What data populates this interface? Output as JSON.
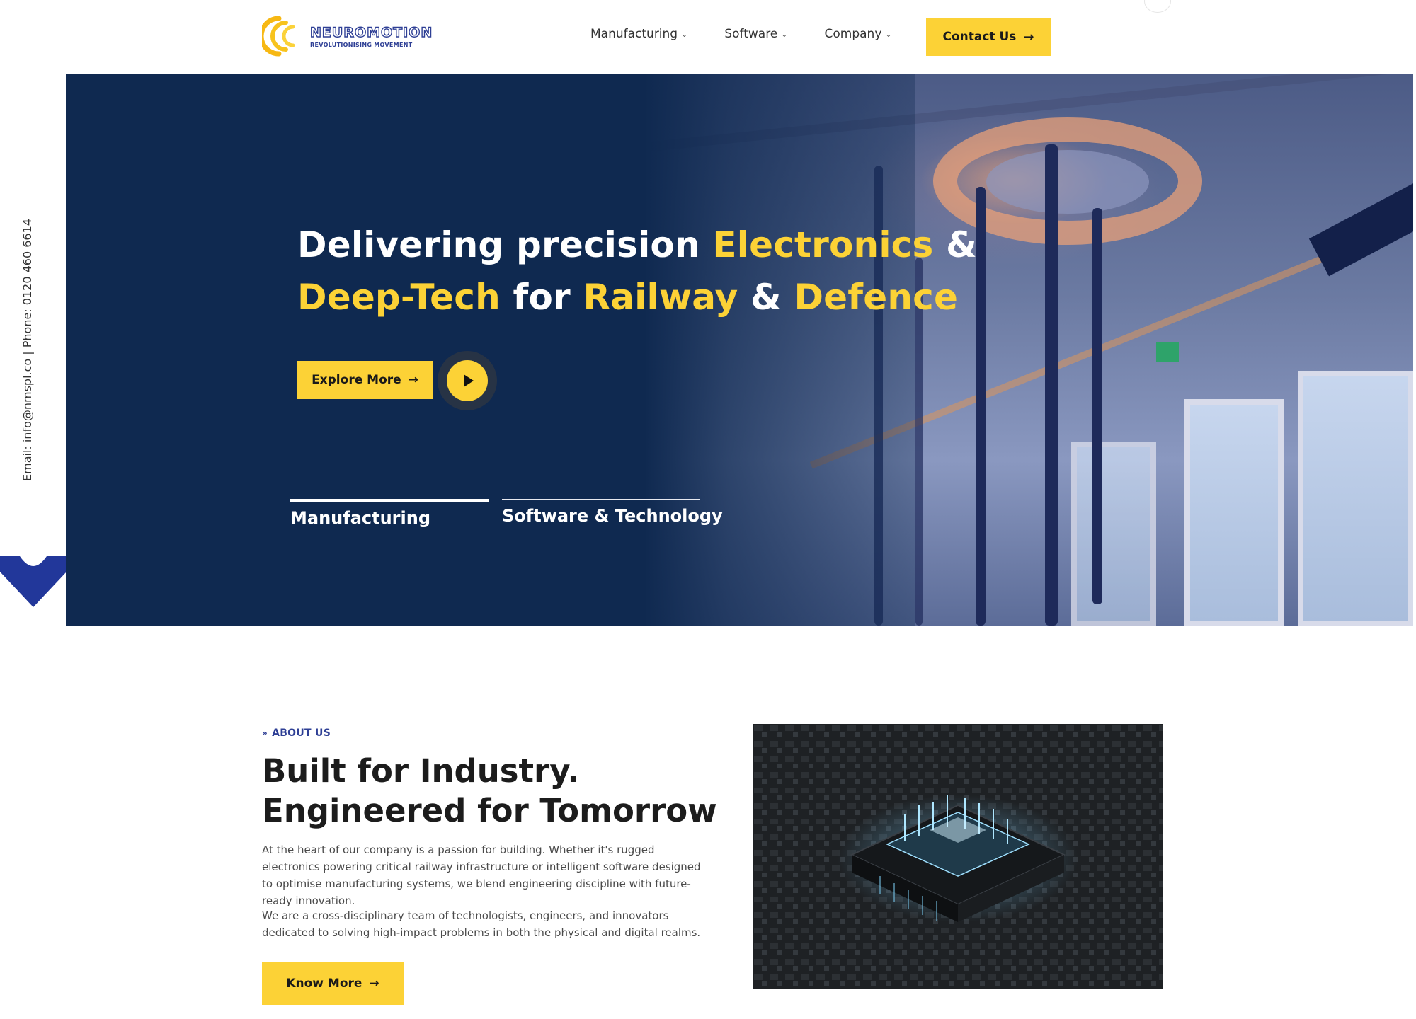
{
  "header": {
    "logo_name": "NEUROMOTION",
    "logo_tagline": "REVOLUTIONISING MOVEMENT",
    "nav": [
      {
        "label": "Manufacturing"
      },
      {
        "label": "Software"
      },
      {
        "label": "Company"
      }
    ],
    "contact_label": "Contact Us"
  },
  "side": {
    "contact_text": "Email: info@nmspl.co | Phone: 0120 460 6614"
  },
  "hero": {
    "line1_a": "Delivering precision ",
    "line1_b": "Electronics",
    "line1_c": " &",
    "line2_a": "Deep-Tech",
    "line2_b": " for ",
    "line2_c": "Railway",
    "line2_d": " & ",
    "line2_e": "Defence",
    "explore_label": "Explore More",
    "tabs": [
      {
        "label": "Manufacturing"
      },
      {
        "label": "Software & Technology"
      }
    ]
  },
  "about": {
    "kicker": "ABOUT US",
    "title_line1": "Built for Industry.",
    "title_line2": "Engineered for Tomorrow",
    "p1": "At the heart of our company is a passion for building. Whether it's rugged electronics powering critical railway infrastructure or intelligent software designed to optimise manufacturing systems, we blend engineering discipline with future-ready innovation.",
    "p2": "We are a cross-disciplinary team of technologists, engineers, and innovators dedicated to solving high-impact problems in both the physical and digital realms.",
    "know_label": "Know More"
  },
  "colors": {
    "accent_yellow": "#fcd236",
    "brand_blue": "#2e3f95",
    "hero_navy": "#0f2950"
  }
}
